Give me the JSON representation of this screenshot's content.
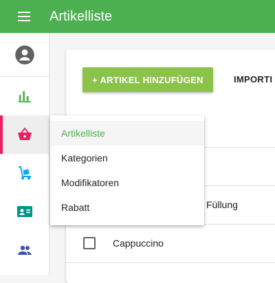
{
  "app": {
    "title": "Artikelliste",
    "accent": "#4caf50"
  },
  "toolbar": {
    "menu_icon": "menu-icon"
  },
  "sidebar": {
    "items": [
      {
        "icon": "account-circle-icon",
        "color": "#616161"
      },
      {
        "icon": "bar-chart-icon",
        "color": "#4caf50"
      },
      {
        "icon": "basket-icon",
        "color": "#e91e63",
        "active": true
      },
      {
        "icon": "hand-truck-icon",
        "color": "#03a9f4"
      },
      {
        "icon": "contact-card-icon",
        "color": "#009688"
      },
      {
        "icon": "people-icon",
        "color": "#3f51b5"
      }
    ]
  },
  "main": {
    "add_button": "+ ARTIKEL HINZUFÜGEN",
    "import_button": "IMPORTI",
    "column_partial": "Füllung",
    "rows": [
      {
        "name": "Cappuccino",
        "checked": false
      }
    ]
  },
  "dropdown": {
    "items": [
      {
        "label": "Artikelliste",
        "selected": true
      },
      {
        "label": "Kategorien"
      },
      {
        "label": "Modifikatoren"
      },
      {
        "label": "Rabatt"
      }
    ]
  }
}
